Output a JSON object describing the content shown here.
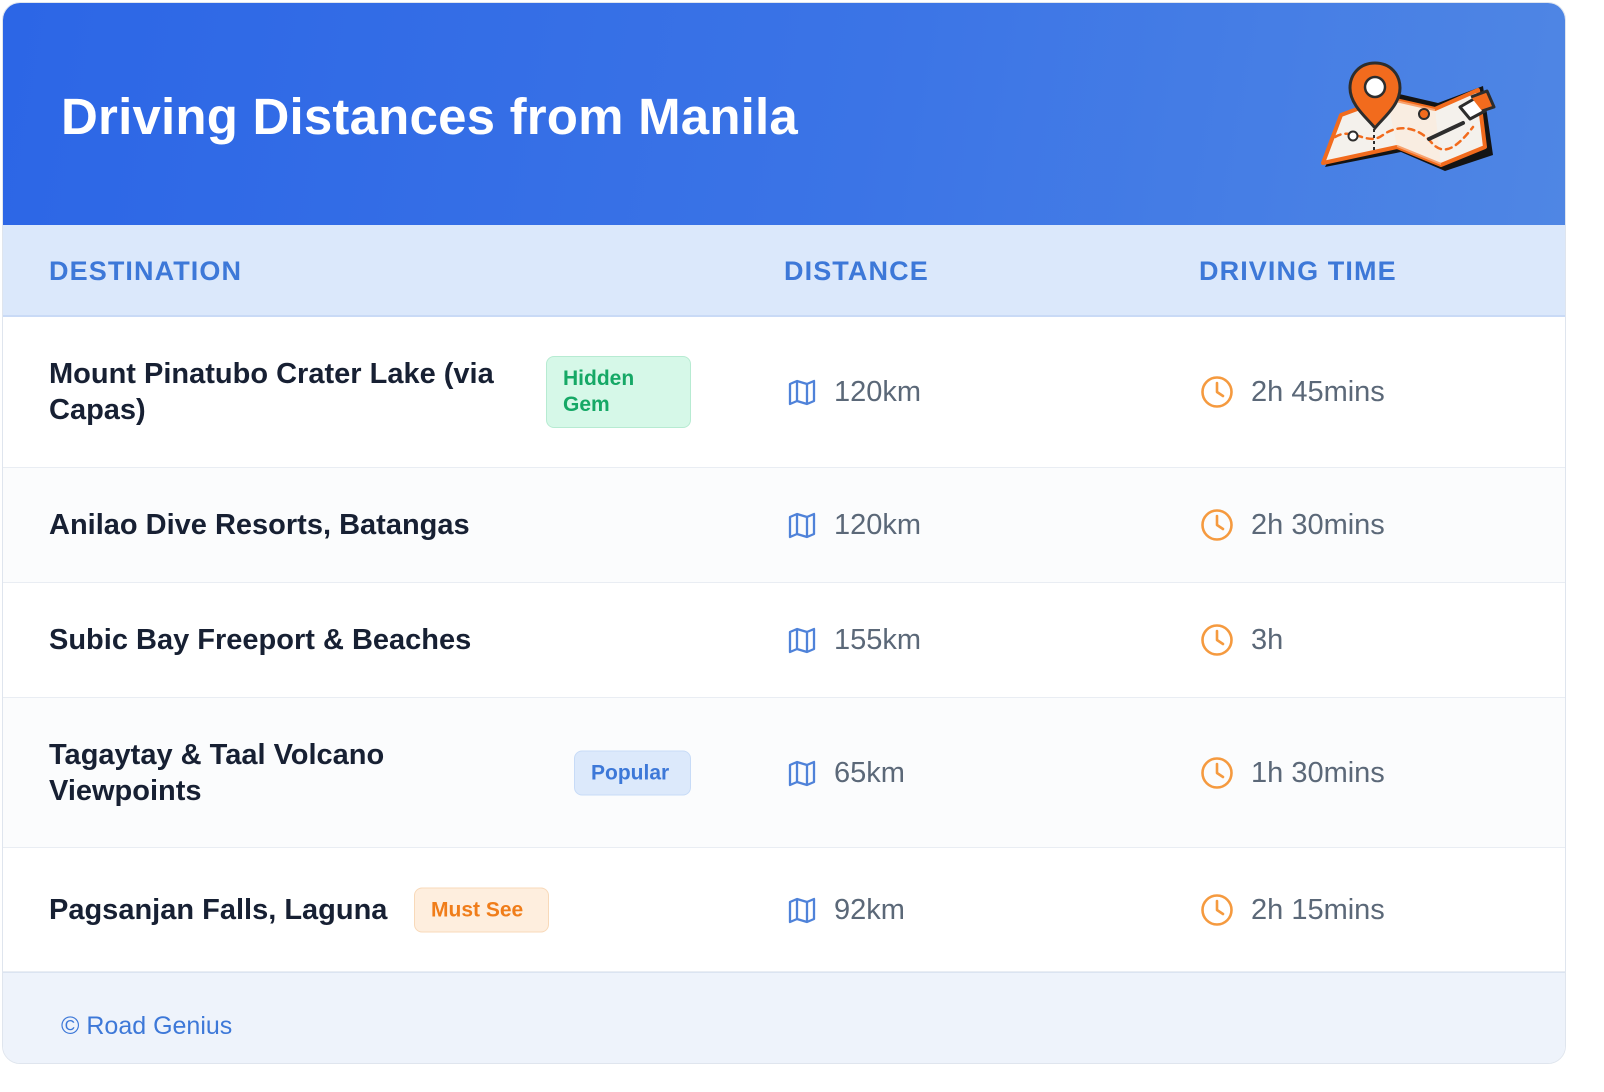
{
  "header": {
    "title": "Driving Distances from Manila",
    "illustration_icon": "folded-map-with-location-pin-icon"
  },
  "table": {
    "columns": [
      "DESTINATION",
      "DISTANCE",
      "DRIVING TIME"
    ],
    "distance_icon": "map-icon",
    "time_icon": "clock-icon",
    "rows": [
      {
        "destination": "Mount Pinatubo Crater Lake (via Capas)",
        "badge": "Hidden Gem",
        "distance": "120km",
        "driving_time": "2h 45mins"
      },
      {
        "destination": "Anilao Dive Resorts, Batangas",
        "badge": "",
        "distance": "120km",
        "driving_time": "2h 30mins"
      },
      {
        "destination": "Subic Bay Freeport & Beaches",
        "badge": "",
        "distance": "155km",
        "driving_time": "3h"
      },
      {
        "destination": "Tagaytay & Taal Volcano Viewpoints",
        "badge": "Popular",
        "distance": "65km",
        "driving_time": "1h 30mins"
      },
      {
        "destination": "Pagsanjan Falls, Laguna",
        "badge": "Must See",
        "distance": "92km",
        "driving_time": "2h 15mins"
      }
    ]
  },
  "footer": {
    "copyright": "© Road Genius"
  },
  "colors": {
    "header_gradient_start": "#2c66e6",
    "header_gradient_end": "#4f86e4",
    "accent_blue": "#3d78d8",
    "badge_green": "#16a866",
    "badge_orange": "#f07d1a",
    "clock_orange": "#f59a3f",
    "text_dark": "#172033",
    "text_muted": "#5b6878"
  }
}
